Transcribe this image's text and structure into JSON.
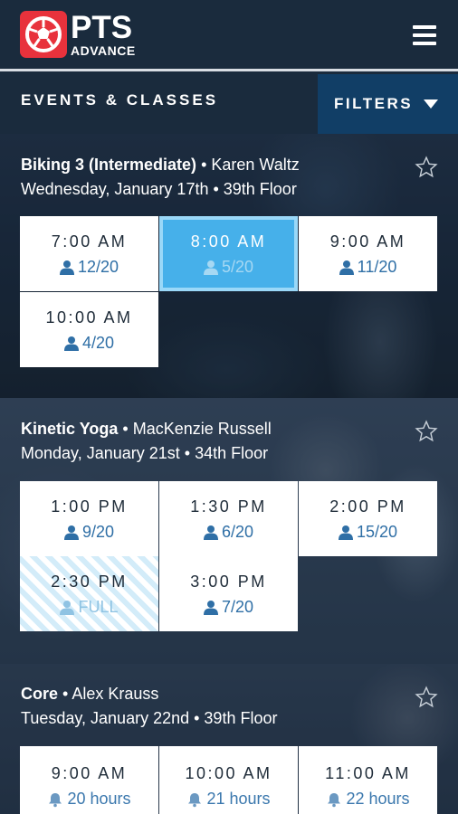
{
  "app": {
    "logo_main": "PTS",
    "logo_sub": "ADVANCE"
  },
  "subbar": {
    "title": "EVENTS & CLASSES",
    "filters_label": "FILTERS"
  },
  "colors": {
    "header_bg": "#1a2b3d",
    "filters_bg": "#113e66",
    "logo_red": "#e8323c",
    "selected_slot": "#46b0ea",
    "capacity_text": "#2f6fa6"
  },
  "icons": {
    "menu": "hamburger-menu-icon",
    "filter_arrow": "triangle-down-icon",
    "favorite": "star-outline-icon",
    "capacity": "person-icon",
    "reminder": "bell-icon"
  },
  "events": [
    {
      "name": "Biking 3 (Intermediate)",
      "separator": "•",
      "instructor": "Karen Waltz",
      "details": "Wednesday, January 17th • 39th Floor",
      "slots": [
        {
          "time": "7:00 AM",
          "capacity": "12/20",
          "state": "available"
        },
        {
          "time": "8:00 AM",
          "capacity": "5/20",
          "state": "selected"
        },
        {
          "time": "9:00 AM",
          "capacity": "11/20",
          "state": "available"
        },
        {
          "time": "10:00 AM",
          "capacity": "4/20",
          "state": "available"
        }
      ]
    },
    {
      "name": "Kinetic Yoga",
      "separator": "•",
      "instructor": "MacKenzie Russell",
      "details": "Monday, January 21st • 34th Floor",
      "slots": [
        {
          "time": "1:00 PM",
          "capacity": "9/20",
          "state": "available"
        },
        {
          "time": "1:30 PM",
          "capacity": "6/20",
          "state": "available"
        },
        {
          "time": "2:00 PM",
          "capacity": "15/20",
          "state": "available"
        },
        {
          "time": "2:30 PM",
          "capacity": "FULL",
          "state": "full"
        },
        {
          "time": "3:00 PM",
          "capacity": "7/20",
          "state": "available"
        }
      ]
    },
    {
      "name": "Core",
      "separator": "•",
      "instructor": "Alex Krauss",
      "details": "Tuesday, January 22nd • 39th Floor",
      "slots": [
        {
          "time": "9:00 AM",
          "capacity": "20 hours",
          "state": "upcoming"
        },
        {
          "time": "10:00 AM",
          "capacity": "21 hours",
          "state": "upcoming"
        },
        {
          "time": "11:00 AM",
          "capacity": "22 hours",
          "state": "upcoming"
        }
      ]
    }
  ]
}
